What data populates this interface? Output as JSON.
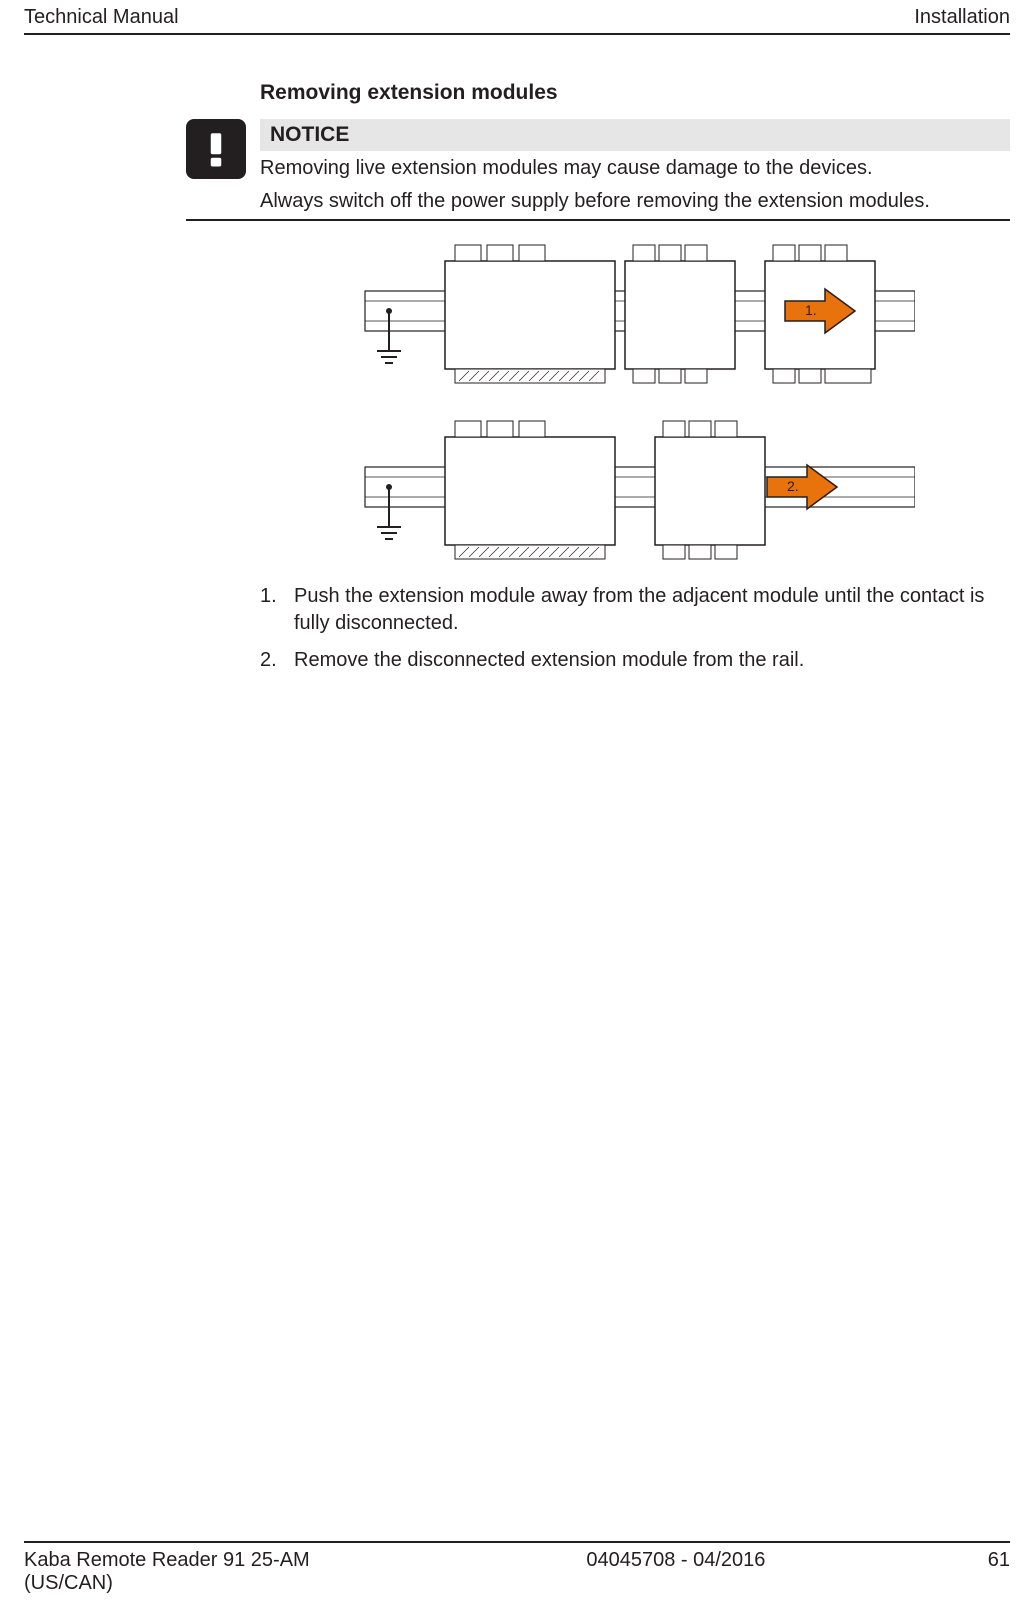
{
  "header": {
    "left": "Technical Manual",
    "right": "Installation"
  },
  "section_title": "Removing extension modules",
  "notice": {
    "label": "NOTICE",
    "line1": "Removing live extension modules may cause damage to the devices.",
    "line2": "Always switch off the power supply before removing the extension modules."
  },
  "diagram": {
    "marker1": "1.",
    "marker2": "2."
  },
  "steps": [
    "Push the extension module away from the adjacent module until the contact is fully disconnected.",
    "Remove the disconnected extension module from the rail."
  ],
  "footer": {
    "left": "Kaba Remote Reader 91 25-AM (US/CAN)",
    "center": "04045708 - 04/2016",
    "right": "61"
  }
}
